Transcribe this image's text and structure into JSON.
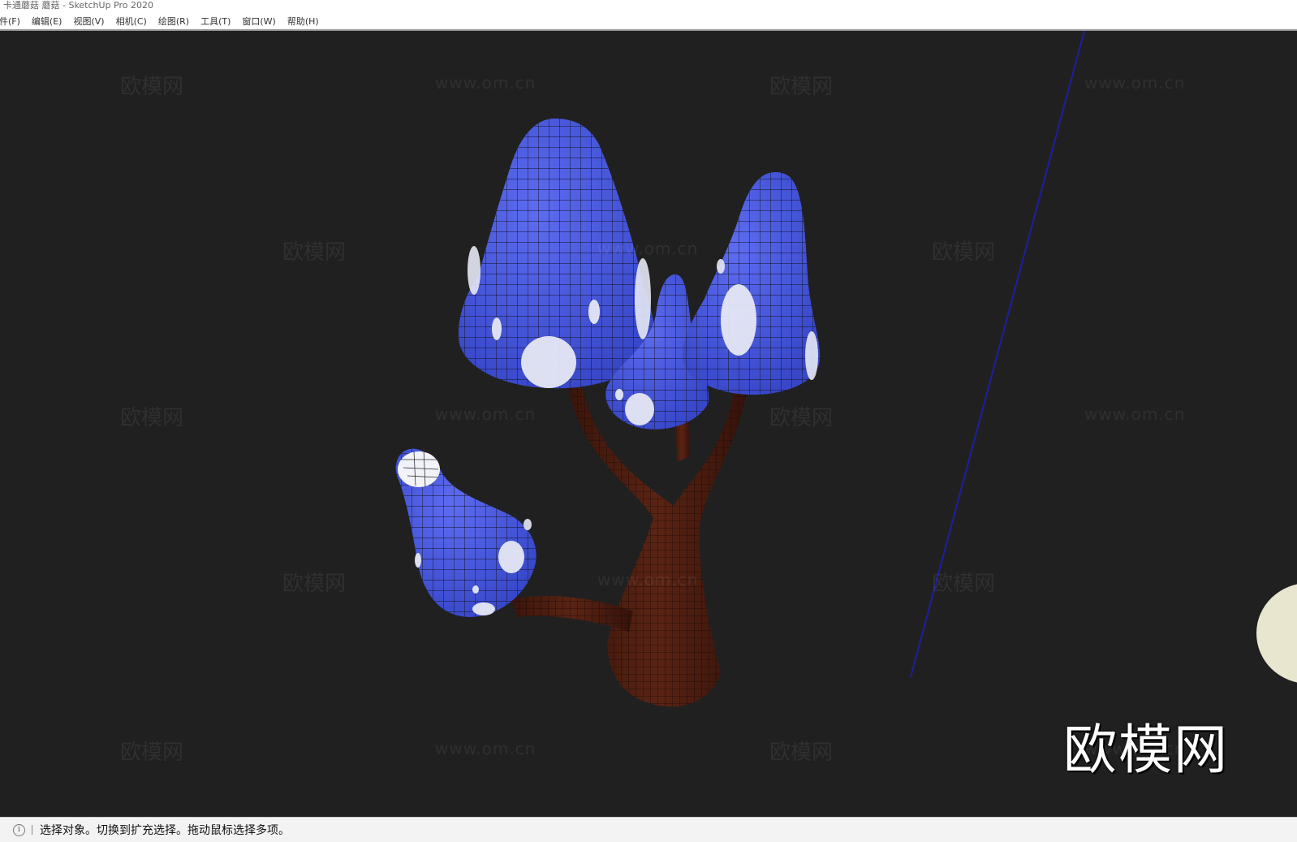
{
  "window": {
    "title": "卡通蘑菇 蘑菇 - SketchUp Pro 2020"
  },
  "menubar": {
    "items": [
      "件(F)",
      "编辑(E)",
      "视图(V)",
      "相机(C)",
      "绘图(R)",
      "工具(T)",
      "窗口(W)",
      "帮助(H)"
    ]
  },
  "watermarks": {
    "logo_text": "欧模网",
    "url_text": "www.om.cn"
  },
  "brand_watermark": {
    "text": "欧模网"
  },
  "statusbar": {
    "message": "选择对象。切换到扩充选择。拖动鼠标选择多项。"
  },
  "colors": {
    "viewport_bg": "#202020",
    "mushroom_cap": "#4a5bdc",
    "spot": "#e6e8f4",
    "stem": "#4a1c10",
    "axis_line": "#1c1fa0",
    "sky_blob": "#e8e6cf"
  },
  "icons": {
    "status": "info-icon"
  }
}
